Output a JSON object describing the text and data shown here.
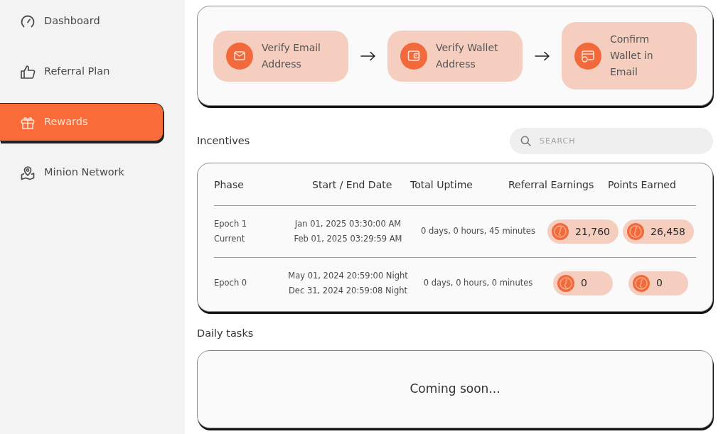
{
  "sidebar": {
    "items": [
      {
        "kind": "dashboard",
        "label": "Dashboard",
        "selected": false
      },
      {
        "kind": "referral",
        "label": "Referral Plan",
        "selected": false
      },
      {
        "kind": "rewards",
        "label": "Rewards",
        "selected": true
      },
      {
        "kind": "network",
        "label": "Minion Network",
        "selected": false
      }
    ]
  },
  "steps": [
    {
      "kind": "email",
      "label": "Verify Email Address"
    },
    {
      "kind": "wallet",
      "label": "Verify Wallet Address"
    },
    {
      "kind": "confirm",
      "label": "Confirm Wallet in Email"
    }
  ],
  "incentives": {
    "title": "Incentives",
    "search": {
      "placeholder": "SEARCH"
    },
    "columns": [
      "Phase",
      "Start / End Date",
      "Total Uptime",
      "Referral Earnings",
      "Points Earned"
    ],
    "rows": [
      {
        "phase": "Epoch 1",
        "status": "Current",
        "start": "Jan 01, 2025 03:30:00 AM",
        "end": "Feb 01, 2025 03:29:59 AM",
        "uptime": "0 days, 0 hours, 45 minutes",
        "referral_earnings": "21,760",
        "points_earned": "26,458"
      },
      {
        "phase": "Epoch 0",
        "start": "May 01, 2024 20:59:00 Night",
        "end": "Dec 31, 2024 20:59:08 Night",
        "uptime": "0 days, 0 hours, 0 minutes",
        "referral_earnings": "0",
        "points_earned": "0"
      }
    ]
  },
  "daily_tasks": {
    "title": "Daily tasks",
    "message": "Coming soon..."
  }
}
